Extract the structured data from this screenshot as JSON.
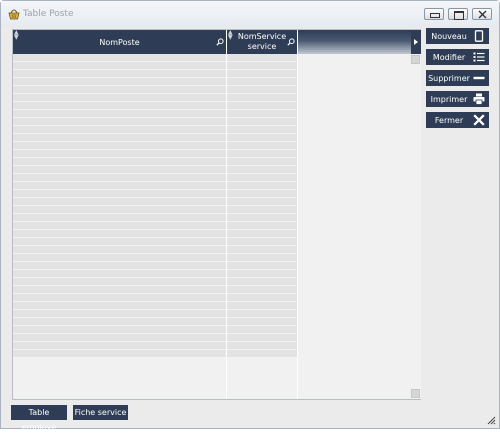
{
  "window": {
    "title": "Table Poste",
    "icon": "basket-icon"
  },
  "grid": {
    "columns": [
      {
        "label": "NomPoste"
      },
      {
        "label": "NomService service"
      }
    ],
    "row_count": 0
  },
  "actions": {
    "new_label": "Nouveau",
    "edit_label": "Modifier",
    "delete_label": "Supprimer",
    "print_label": "Imprimer",
    "close_label": "Fermer"
  },
  "footer": {
    "employee_table_label": "Table employe",
    "service_sheet_label": "Fiche service"
  },
  "colors": {
    "accent": "#2e3d55",
    "window_bg": "#ebebeb",
    "row_bg": "#e3e3e3"
  }
}
